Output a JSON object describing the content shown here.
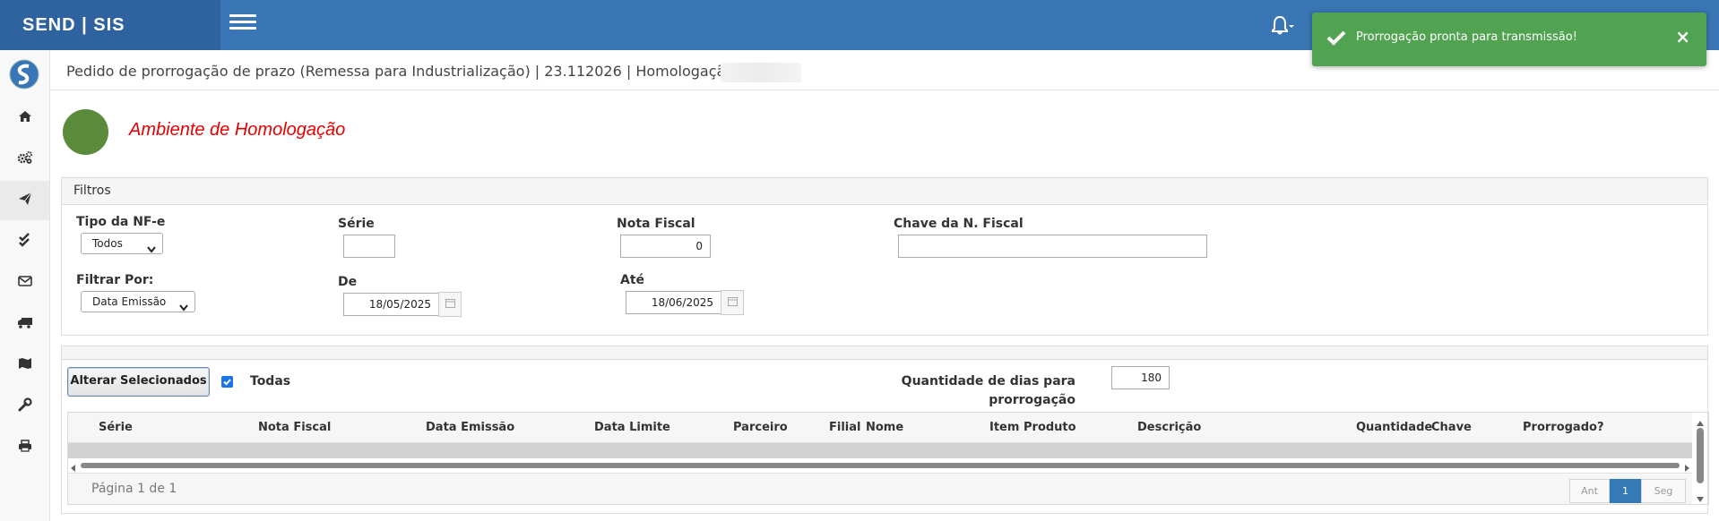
{
  "app": {
    "brand": "SEND | SIS"
  },
  "toast": {
    "message": "Prorrogação pronta para transmissão!",
    "close": "×",
    "color": "#51a351"
  },
  "sidebar": {
    "items": [
      {
        "icon": "home-icon"
      },
      {
        "icon": "cogs-icon"
      },
      {
        "icon": "send-icon"
      },
      {
        "icon": "check-double-icon"
      },
      {
        "icon": "envelope-icon"
      },
      {
        "icon": "truck-icon"
      },
      {
        "icon": "map-icon"
      },
      {
        "icon": "wrench-icon"
      },
      {
        "icon": "print-icon"
      }
    ],
    "active_index": 2
  },
  "breadcrumb": "Pedido de prorrogação de prazo (Remessa para Industrialização) | 23.112026 | Homologação |",
  "environment": {
    "label": "Ambiente de Homologação",
    "status_color": "#5b8a3b",
    "text_color": "#e60000"
  },
  "filters": {
    "heading": "Filtros",
    "tipo_nfe": {
      "label": "Tipo da NF-e",
      "value": "Todos"
    },
    "serie": {
      "label": "Série",
      "value": ""
    },
    "nota_fiscal": {
      "label": "Nota Fiscal",
      "value": "0"
    },
    "chave": {
      "label": "Chave da N. Fiscal",
      "value": ""
    },
    "filtrar_por": {
      "label": "Filtrar Por:",
      "value": "Data Emissão"
    },
    "de": {
      "label": "De",
      "value": "18/05/2025"
    },
    "ate": {
      "label": "Até",
      "value": "18/06/2025"
    }
  },
  "actions": {
    "alterar_label": "Alterar Selecionados",
    "todas_label": "Todas",
    "todas_checked": true,
    "dias_label_1": "Quantidade de dias para",
    "dias_label_2": "prorrogação",
    "dias_value": "180"
  },
  "grid": {
    "columns": [
      "Série",
      "Nota Fiscal",
      "Data Emissão",
      "Data Limite",
      "Parceiro",
      "Filial",
      "Nome",
      "Item",
      "Produto",
      "Descrição",
      "Quantidade",
      "Chave",
      "Prorrogado?"
    ],
    "page_info": "Página 1 de 1",
    "pager": {
      "prev": "Ant",
      "current": "1",
      "next": "Seg"
    }
  }
}
